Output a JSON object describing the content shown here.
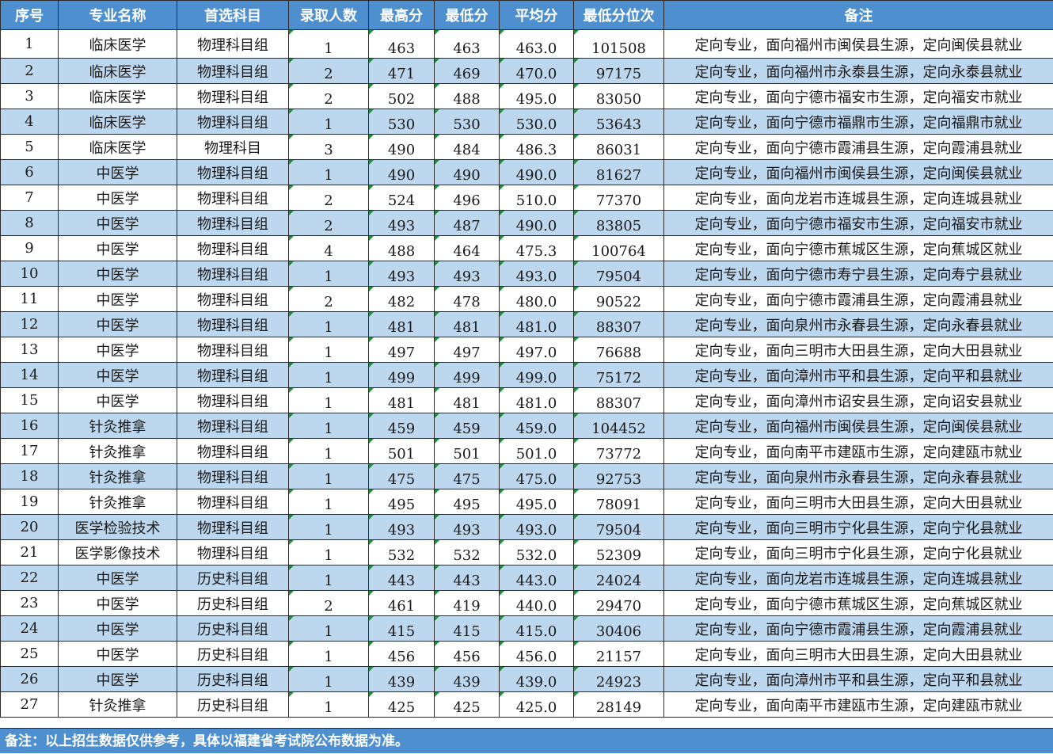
{
  "headers": {
    "idx": "序号",
    "major": "专业名称",
    "subject": "首选科目",
    "enrolled": "录取人数",
    "max": "最高分",
    "min": "最低分",
    "avg": "平均分",
    "rank": "最低分位次",
    "note": "备注"
  },
  "rows": [
    {
      "idx": "1",
      "major": "临床医学",
      "subject": "物理科目组",
      "enrolled": "1",
      "max": "463",
      "min": "463",
      "avg": "463.0",
      "rank": "101508",
      "note": "定向专业，面向福州市闽侯县生源，定向闽侯县就业"
    },
    {
      "idx": "2",
      "major": "临床医学",
      "subject": "物理科目组",
      "enrolled": "2",
      "max": "471",
      "min": "469",
      "avg": "470.0",
      "rank": "97175",
      "note": "定向专业，面向福州市永泰县生源，定向永泰县就业"
    },
    {
      "idx": "3",
      "major": "临床医学",
      "subject": "物理科目组",
      "enrolled": "2",
      "max": "502",
      "min": "488",
      "avg": "495.0",
      "rank": "83050",
      "note": "定向专业，面向宁德市福安市生源，定向福安市就业"
    },
    {
      "idx": "4",
      "major": "临床医学",
      "subject": "物理科目组",
      "enrolled": "1",
      "max": "530",
      "min": "530",
      "avg": "530.0",
      "rank": "53643",
      "note": "定向专业，面向宁德市福鼎市生源，定向福鼎市就业"
    },
    {
      "idx": "5",
      "major": "临床医学",
      "subject": "物理科目",
      "enrolled": "3",
      "max": "490",
      "min": "484",
      "avg": "486.3",
      "rank": "86031",
      "note": "定向专业，面向宁德市霞浦县生源，定向霞浦县就业"
    },
    {
      "idx": "6",
      "major": "中医学",
      "subject": "物理科目组",
      "enrolled": "1",
      "max": "490",
      "min": "490",
      "avg": "490.0",
      "rank": "81627",
      "note": "定向专业，面向福州市闽侯县生源，定向闽侯县就业"
    },
    {
      "idx": "7",
      "major": "中医学",
      "subject": "物理科目组",
      "enrolled": "2",
      "max": "524",
      "min": "496",
      "avg": "510.0",
      "rank": "77370",
      "note": "定向专业，面向龙岩市连城县生源，定向连城县就业"
    },
    {
      "idx": "8",
      "major": "中医学",
      "subject": "物理科目组",
      "enrolled": "2",
      "max": "493",
      "min": "487",
      "avg": "490.0",
      "rank": "83805",
      "note": "定向专业，面向宁德市福安市生源，定向福安市就业"
    },
    {
      "idx": "9",
      "major": "中医学",
      "subject": "物理科目组",
      "enrolled": "4",
      "max": "488",
      "min": "464",
      "avg": "475.3",
      "rank": "100764",
      "note": "定向专业，面向宁德市蕉城区生源，定向蕉城区就业"
    },
    {
      "idx": "10",
      "major": "中医学",
      "subject": "物理科目组",
      "enrolled": "1",
      "max": "493",
      "min": "493",
      "avg": "493.0",
      "rank": "79504",
      "note": "定向专业，面向宁德市寿宁县生源，定向寿宁县就业"
    },
    {
      "idx": "11",
      "major": "中医学",
      "subject": "物理科目组",
      "enrolled": "2",
      "max": "482",
      "min": "478",
      "avg": "480.0",
      "rank": "90522",
      "note": "定向专业，面向宁德市霞浦县生源，定向霞浦县就业"
    },
    {
      "idx": "12",
      "major": "中医学",
      "subject": "物理科目组",
      "enrolled": "1",
      "max": "481",
      "min": "481",
      "avg": "481.0",
      "rank": "88307",
      "note": "定向专业，面向泉州市永春县生源，定向永春县就业"
    },
    {
      "idx": "13",
      "major": "中医学",
      "subject": "物理科目组",
      "enrolled": "1",
      "max": "497",
      "min": "497",
      "avg": "497.0",
      "rank": "76688",
      "note": "定向专业，面向三明市大田县生源，定向大田县就业"
    },
    {
      "idx": "14",
      "major": "中医学",
      "subject": "物理科目组",
      "enrolled": "1",
      "max": "499",
      "min": "499",
      "avg": "499.0",
      "rank": "75172",
      "note": "定向专业，面向漳州市平和县生源，定向平和县就业"
    },
    {
      "idx": "15",
      "major": "中医学",
      "subject": "物理科目组",
      "enrolled": "1",
      "max": "481",
      "min": "481",
      "avg": "481.0",
      "rank": "88307",
      "note": "定向专业，面向漳州市诏安县生源，定向诏安县就业"
    },
    {
      "idx": "16",
      "major": "针灸推拿",
      "subject": "物理科目组",
      "enrolled": "1",
      "max": "459",
      "min": "459",
      "avg": "459.0",
      "rank": "104452",
      "note": "定向专业，面向福州市闽侯县生源，定向闽侯县就业"
    },
    {
      "idx": "17",
      "major": "针灸推拿",
      "subject": "物理科目组",
      "enrolled": "1",
      "max": "501",
      "min": "501",
      "avg": "501.0",
      "rank": "73772",
      "note": "定向专业，面向南平市建瓯市生源，定向建瓯市就业"
    },
    {
      "idx": "18",
      "major": "针灸推拿",
      "subject": "物理科目组",
      "enrolled": "1",
      "max": "475",
      "min": "475",
      "avg": "475.0",
      "rank": "92753",
      "note": "定向专业，面向泉州市永春县生源，定向永春县就业"
    },
    {
      "idx": "19",
      "major": "针灸推拿",
      "subject": "物理科目组",
      "enrolled": "1",
      "max": "495",
      "min": "495",
      "avg": "495.0",
      "rank": "78091",
      "note": "定向专业，面向三明市大田县生源，定向大田县就业"
    },
    {
      "idx": "20",
      "major": "医学检验技术",
      "subject": "物理科目组",
      "enrolled": "1",
      "max": "493",
      "min": "493",
      "avg": "493.0",
      "rank": "79504",
      "note": "定向专业，面向三明市宁化县生源，定向宁化县就业"
    },
    {
      "idx": "21",
      "major": "医学影像技术",
      "subject": "物理科目组",
      "enrolled": "1",
      "max": "532",
      "min": "532",
      "avg": "532.0",
      "rank": "52309",
      "note": "定向专业，面向三明市宁化县生源，定向宁化县就业"
    },
    {
      "idx": "22",
      "major": "中医学",
      "subject": "历史科目组",
      "enrolled": "1",
      "max": "443",
      "min": "443",
      "avg": "443.0",
      "rank": "24024",
      "note": "定向专业，面向龙岩市连城县生源，定向连城县就业"
    },
    {
      "idx": "23",
      "major": "中医学",
      "subject": "历史科目组",
      "enrolled": "2",
      "max": "461",
      "min": "419",
      "avg": "440.0",
      "rank": "29470",
      "note": "定向专业，面向宁德市蕉城区生源，定向蕉城区就业"
    },
    {
      "idx": "24",
      "major": "中医学",
      "subject": "历史科目组",
      "enrolled": "1",
      "max": "415",
      "min": "415",
      "avg": "415.0",
      "rank": "30406",
      "note": "定向专业，面向宁德市霞浦县生源，定向霞浦县就业"
    },
    {
      "idx": "25",
      "major": "中医学",
      "subject": "历史科目组",
      "enrolled": "1",
      "max": "456",
      "min": "456",
      "avg": "456.0",
      "rank": "21157",
      "note": "定向专业，面向三明市大田县生源，定向大田县就业"
    },
    {
      "idx": "26",
      "major": "中医学",
      "subject": "历史科目组",
      "enrolled": "1",
      "max": "439",
      "min": "439",
      "avg": "439.0",
      "rank": "24923",
      "note": "定向专业，面向漳州市平和县生源，定向平和县就业"
    },
    {
      "idx": "27",
      "major": "针灸推拿",
      "subject": "历史科目组",
      "enrolled": "1",
      "max": "425",
      "min": "425",
      "avg": "425.0",
      "rank": "28149",
      "note": "定向专业，面向南平市建瓯市生源，定向建瓯市就业"
    }
  ],
  "footnote": "备注：以上招生数据仅供参考，具体以福建省考试院公布数据为准。",
  "colors": {
    "header_bg": "#4e8fd0",
    "stripe": "#bdd7ee",
    "marker": "#1f8f3a"
  }
}
